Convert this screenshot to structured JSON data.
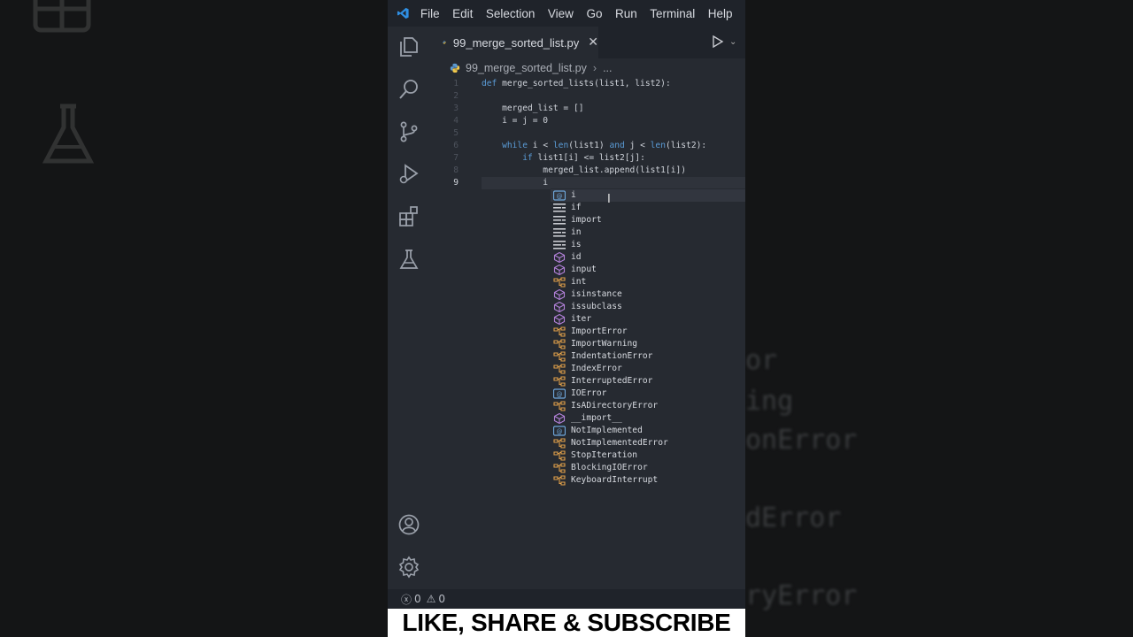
{
  "menubar": {
    "items": [
      "File",
      "Edit",
      "Selection",
      "View",
      "Go",
      "Run",
      "Terminal",
      "Help"
    ]
  },
  "tab": {
    "label": "99_merge_sorted_list.py"
  },
  "breadcrumb": {
    "file": "99_merge_sorted_list.py",
    "more": "..."
  },
  "editor": {
    "lines": [
      {
        "num": "1",
        "code": "def merge_sorted_lists(list1, list2):"
      },
      {
        "num": "2",
        "code": ""
      },
      {
        "num": "3",
        "code": "    merged_list = []"
      },
      {
        "num": "4",
        "code": "    i = j = 0"
      },
      {
        "num": "5",
        "code": ""
      },
      {
        "num": "6",
        "code": "    while i < len(list1) and j < len(list2):"
      },
      {
        "num": "7",
        "code": "        if list1[i] <= list2[j]:"
      },
      {
        "num": "8",
        "code": "            merged_list.append(list1[i])"
      },
      {
        "num": "9",
        "code": "            i"
      }
    ]
  },
  "suggestions": [
    {
      "label": "i",
      "kind": "variable"
    },
    {
      "label": "if",
      "kind": "keyword"
    },
    {
      "label": "import",
      "kind": "keyword"
    },
    {
      "label": "in",
      "kind": "keyword"
    },
    {
      "label": "is",
      "kind": "keyword"
    },
    {
      "label": "id",
      "kind": "function"
    },
    {
      "label": "input",
      "kind": "function"
    },
    {
      "label": "int",
      "kind": "class"
    },
    {
      "label": "isinstance",
      "kind": "function"
    },
    {
      "label": "issubclass",
      "kind": "function"
    },
    {
      "label": "iter",
      "kind": "function"
    },
    {
      "label": "ImportError",
      "kind": "class"
    },
    {
      "label": "ImportWarning",
      "kind": "class"
    },
    {
      "label": "IndentationError",
      "kind": "class"
    },
    {
      "label": "IndexError",
      "kind": "class"
    },
    {
      "label": "InterruptedError",
      "kind": "class"
    },
    {
      "label": "IOError",
      "kind": "variable"
    },
    {
      "label": "IsADirectoryError",
      "kind": "class"
    },
    {
      "label": "__import__",
      "kind": "function"
    },
    {
      "label": "NotImplemented",
      "kind": "variable"
    },
    {
      "label": "NotImplementedError",
      "kind": "class"
    },
    {
      "label": "StopIteration",
      "kind": "class"
    },
    {
      "label": "BlockingIOError",
      "kind": "class"
    },
    {
      "label": "KeyboardInterrupt",
      "kind": "class"
    }
  ],
  "status": {
    "errors": "0",
    "warnings": "0"
  },
  "banner": {
    "text": "LIKE, SHARE & SUBSCRIBE"
  },
  "background_ghosts": [
    "or",
    "ing",
    "onError",
    "dError",
    "ryError"
  ],
  "colors": {
    "keyword": "#5a9bd6",
    "class_icon": "#e2a14a",
    "function_icon": "#b180d7",
    "variable_icon": "#6fa8dc"
  }
}
